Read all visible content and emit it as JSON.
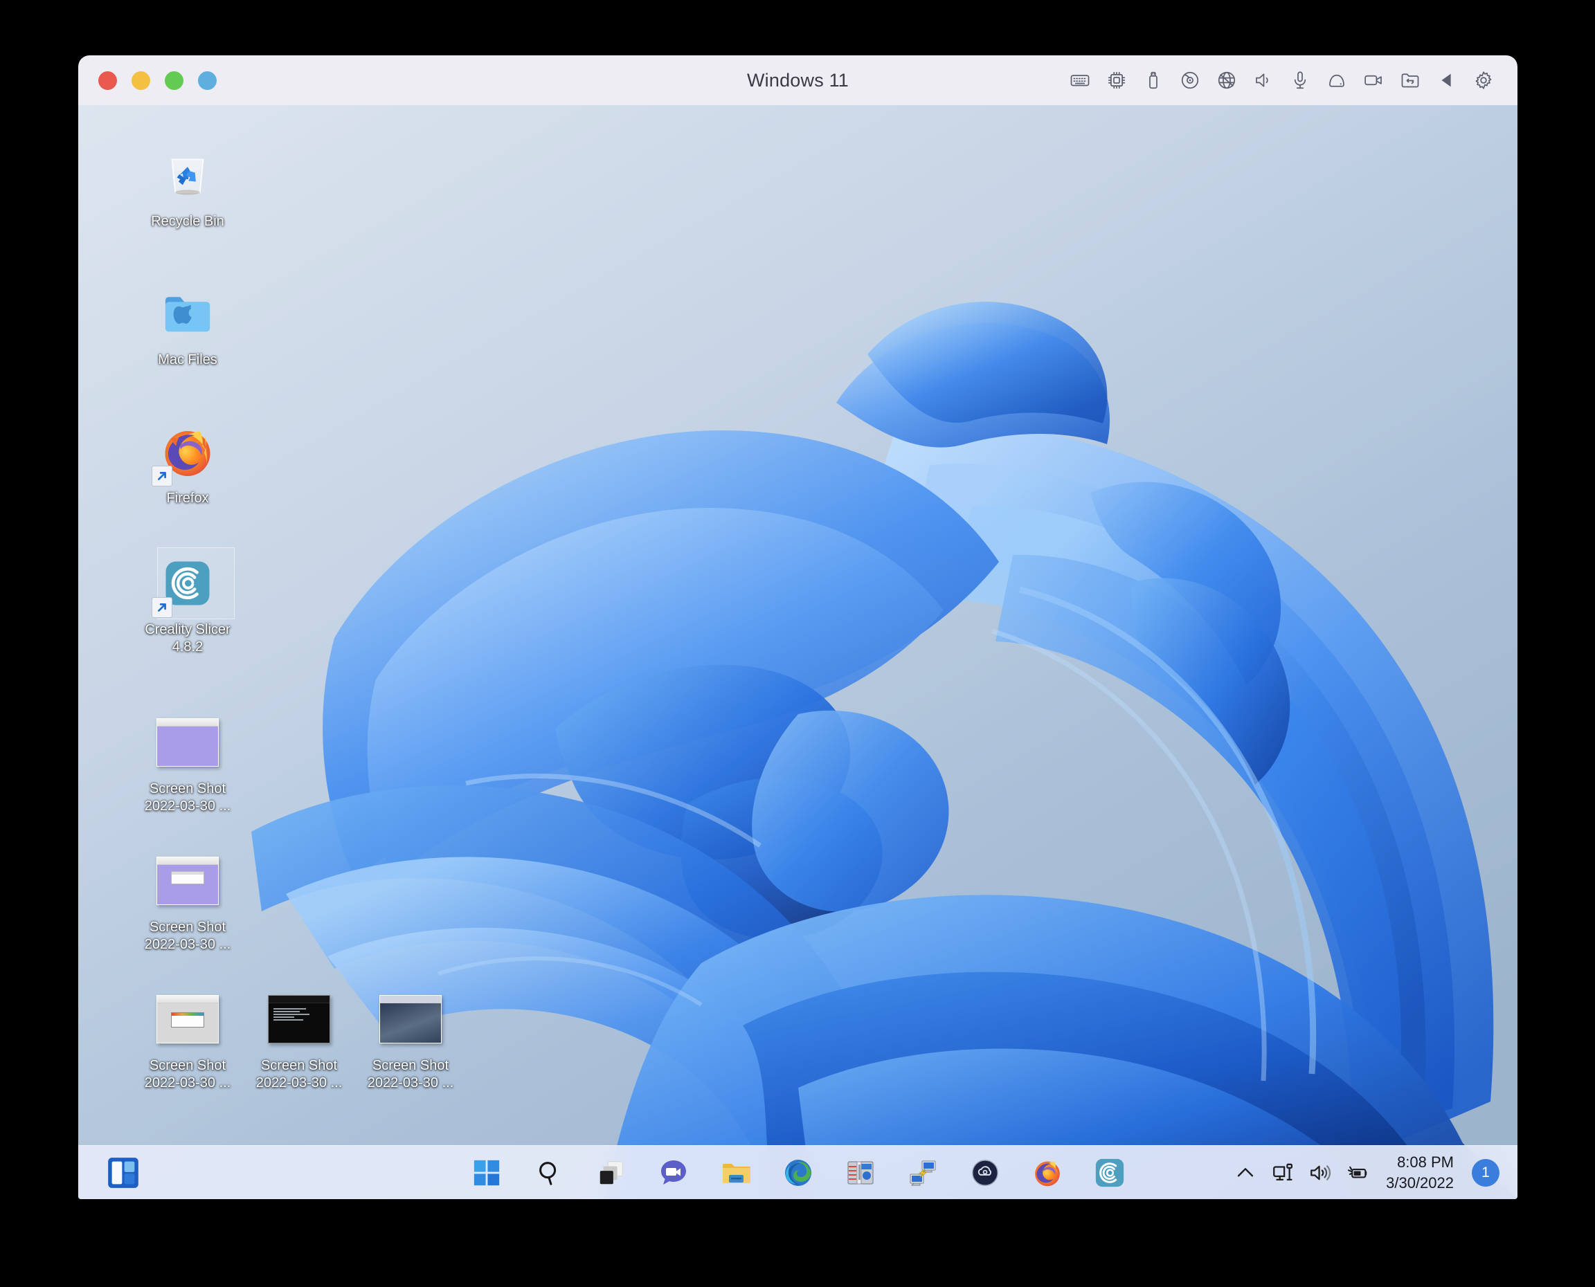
{
  "window": {
    "title": "Windows 11",
    "traffic_lights": [
      {
        "name": "close",
        "color": "#e8594e"
      },
      {
        "name": "minimize",
        "color": "#f4c042"
      },
      {
        "name": "maximize",
        "color": "#63cb51"
      },
      {
        "name": "fullscreen",
        "color": "#5eaee0"
      }
    ],
    "toolbar_icons": [
      "keyboard-icon",
      "cpu-icon",
      "usb-drive-icon",
      "optical-disc-icon",
      "network-globe-icon",
      "speaker-icon",
      "microphone-icon",
      "hard-drive-icon",
      "camera-icon",
      "shared-folder-icon",
      "play-triangle-icon",
      "gear-icon"
    ]
  },
  "desktop": {
    "icons": [
      {
        "name": "recycle-bin",
        "label": "Recycle Bin",
        "type": "recycle",
        "shortcut": false,
        "selected": false
      },
      {
        "name": "mac-files-folder",
        "label": "Mac Files",
        "type": "folder",
        "shortcut": false,
        "selected": false
      },
      {
        "name": "firefox",
        "label": "Firefox",
        "type": "firefox",
        "shortcut": true,
        "selected": false
      },
      {
        "name": "creality-slicer",
        "label": "Creality Slicer 4.8.2",
        "type": "creality",
        "shortcut": true,
        "selected": true
      },
      {
        "name": "screenshot-1",
        "label": "Screen Shot 2022-03-30 ...",
        "type": "thumb-purple",
        "shortcut": false,
        "selected": false
      },
      {
        "name": "screenshot-2",
        "label": "Screen Shot 2022-03-30 ...",
        "type": "thumb-purple-win",
        "shortcut": false,
        "selected": false
      },
      {
        "name": "screenshot-3",
        "label": "Screen Shot 2022-03-30 ...",
        "type": "thumb-gray",
        "shortcut": false,
        "selected": false
      },
      {
        "name": "screenshot-4",
        "label": "Screen Shot 2022-03-30 ...",
        "type": "thumb-terminal",
        "shortcut": false,
        "selected": false
      },
      {
        "name": "screenshot-5",
        "label": "Screen Shot 2022-03-30 ...",
        "type": "thumb-darkblue",
        "shortcut": false,
        "selected": false
      }
    ]
  },
  "taskbar": {
    "widgets_icon": "widgets-icon",
    "apps": [
      {
        "name": "start-button",
        "icon": "windows-logo-icon"
      },
      {
        "name": "search-button",
        "icon": "search-icon"
      },
      {
        "name": "task-view-button",
        "icon": "task-view-icon"
      },
      {
        "name": "chat-button",
        "icon": "teams-chat-icon"
      },
      {
        "name": "file-explorer-button",
        "icon": "file-explorer-icon"
      },
      {
        "name": "microsoft-edge-button",
        "icon": "edge-icon"
      },
      {
        "name": "winzip-button",
        "icon": "winzip-icon"
      },
      {
        "name": "remote-desktop-button",
        "icon": "remote-desktop-icon"
      },
      {
        "name": "dark-app-button",
        "icon": "cloud-app-icon"
      },
      {
        "name": "firefox-button",
        "icon": "firefox-icon"
      },
      {
        "name": "creality-slicer-button",
        "icon": "creality-icon"
      }
    ],
    "tray": {
      "icons": [
        "chevron-up-icon",
        "network-monitor-icon",
        "volume-icon",
        "battery-charging-icon"
      ],
      "time": "8:08 PM",
      "date": "3/30/2022",
      "notification_count": "1",
      "notification_color": "#3a7ddc"
    }
  }
}
